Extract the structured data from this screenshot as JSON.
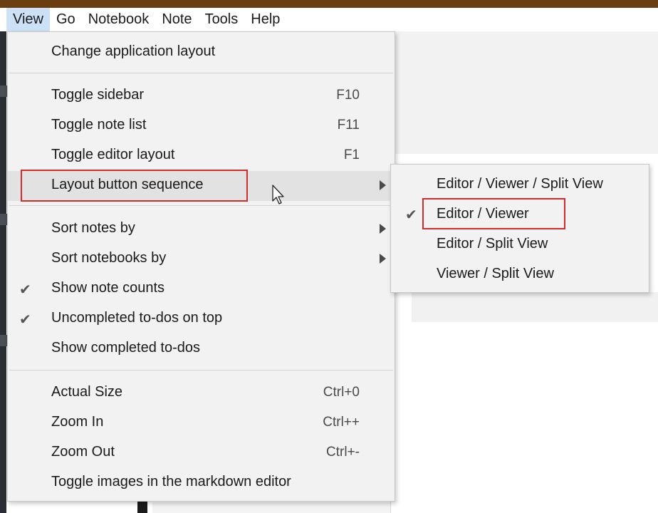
{
  "menubar": {
    "items": [
      "View",
      "Go",
      "Notebook",
      "Note",
      "Tools",
      "Help"
    ]
  },
  "view_menu": {
    "items": [
      {
        "label": "Change application layout",
        "accel": "",
        "checked": false,
        "submenu": false
      },
      {
        "label": "Toggle sidebar",
        "accel": "F10",
        "checked": false,
        "submenu": false
      },
      {
        "label": "Toggle note list",
        "accel": "F11",
        "checked": false,
        "submenu": false
      },
      {
        "label": "Toggle editor layout",
        "accel": "F1",
        "checked": false,
        "submenu": false
      },
      {
        "label": "Layout button sequence",
        "accel": "",
        "checked": false,
        "submenu": true
      },
      {
        "label": "Sort notes by",
        "accel": "",
        "checked": false,
        "submenu": true
      },
      {
        "label": "Sort notebooks by",
        "accel": "",
        "checked": false,
        "submenu": true
      },
      {
        "label": "Show note counts",
        "accel": "",
        "checked": true,
        "submenu": false
      },
      {
        "label": "Uncompleted to-dos on top",
        "accel": "",
        "checked": true,
        "submenu": false
      },
      {
        "label": "Show completed to-dos",
        "accel": "",
        "checked": false,
        "submenu": false
      },
      {
        "label": "Actual Size",
        "accel": "Ctrl+0",
        "checked": false,
        "submenu": false
      },
      {
        "label": "Zoom In",
        "accel": "Ctrl++",
        "checked": false,
        "submenu": false
      },
      {
        "label": "Zoom Out",
        "accel": "Ctrl+-",
        "checked": false,
        "submenu": false
      },
      {
        "label": "Toggle images in the markdown editor",
        "accel": "",
        "checked": false,
        "submenu": false
      }
    ]
  },
  "layout_submenu": {
    "items": [
      {
        "label": "Editor / Viewer / Split View",
        "checked": false
      },
      {
        "label": "Editor / Viewer",
        "checked": true
      },
      {
        "label": "Editor / Split View",
        "checked": false
      },
      {
        "label": "Viewer / Split View",
        "checked": false
      }
    ]
  },
  "glyphs": {
    "check": "✔"
  },
  "colors": {
    "titlebar": "#6b3e12",
    "menubar_active": "#cce1f5",
    "menu_bg": "#f2f2f2",
    "highlight_box": "#d42c2c"
  }
}
